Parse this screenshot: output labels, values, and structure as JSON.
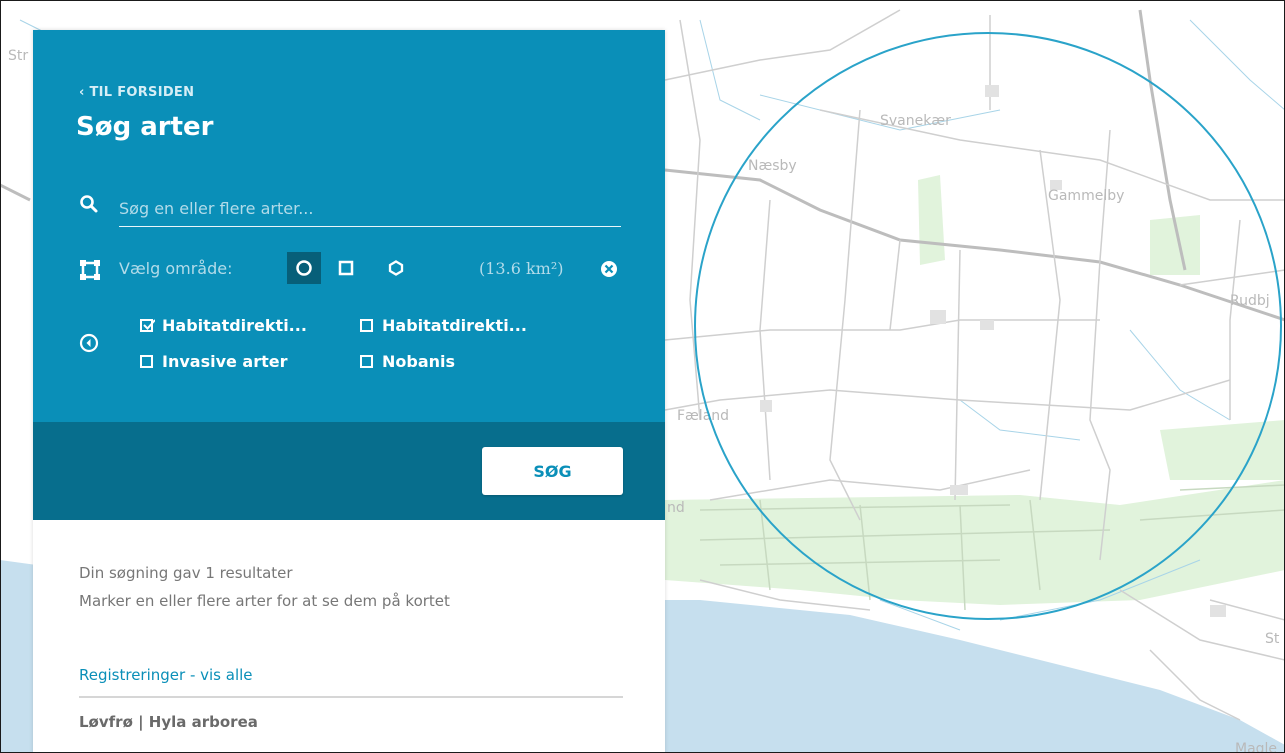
{
  "panel": {
    "back_link": "‹ TIL FORSIDEN",
    "title": "Søg arter",
    "search_placeholder": "Søg en eller flere arter...",
    "area_label": "Vælg område:",
    "area_size": "(13.6 km²)",
    "filters": [
      {
        "label": "Habitatdirekti...",
        "checked": true
      },
      {
        "label": "Habitatdirekti...",
        "checked": false
      },
      {
        "label": "Invasive arter",
        "checked": false
      },
      {
        "label": "Nobanis",
        "checked": false
      }
    ],
    "search_button": "SØG",
    "result_count": "Din søgning gav 1 resultater",
    "result_hint": "Marker en eller flere arter for at se dem på kortet",
    "registrations_link": "Registreringer - vis alle",
    "species": "Løvfrø | Hyla arborea"
  },
  "map": {
    "places": [
      "Svanekær",
      "Næsby",
      "Gammelby",
      "Rudbj",
      "Fæland",
      "nd",
      "St",
      "Str",
      "Magle"
    ],
    "colors": {
      "accent": "#0a8fb8",
      "accent_dark": "#076e8d",
      "circle": "#2aa3c9",
      "water": "#c6dfee",
      "green": "#e1f3dc"
    }
  }
}
